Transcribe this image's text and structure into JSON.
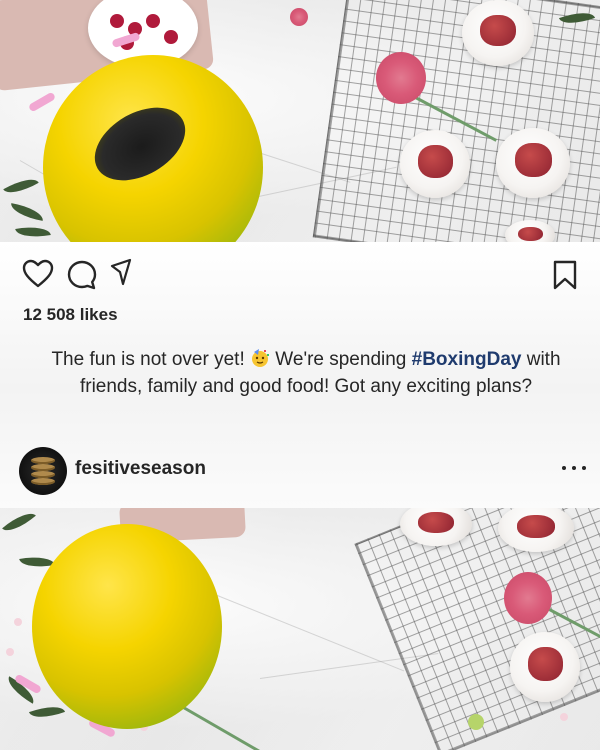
{
  "post": {
    "likes": "12 508 likes",
    "caption_part1": "The fun is not over yet!",
    "caption_part2": " We're spending ",
    "hashtag": "#BoxingDay",
    "caption_part3": " with friends, family and good food! Got any exciting plans?",
    "username": "fesitiveseason"
  },
  "icons": {
    "like": "heart-icon",
    "comment": "comment-icon",
    "share": "share-icon",
    "save": "bookmark-icon",
    "more": "more-options-icon",
    "party": "party-face-emoji"
  },
  "colors": {
    "text": "#262626",
    "hashtag": "#1f3b6e",
    "panel": "#ffffff"
  }
}
